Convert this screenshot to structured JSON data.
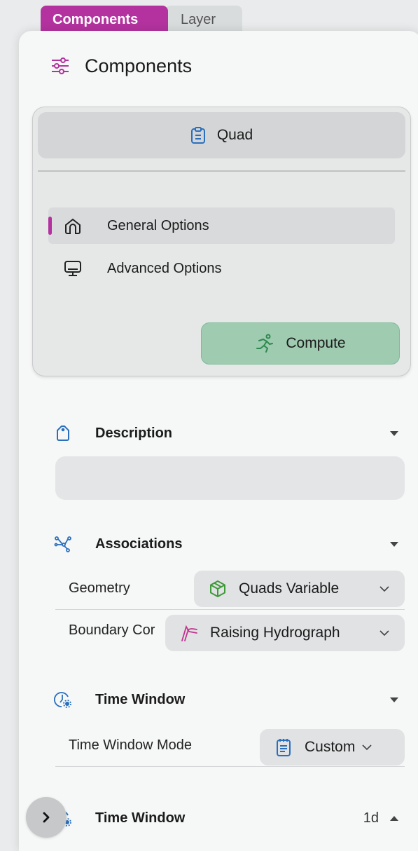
{
  "tabs": [
    {
      "label": "Components",
      "active": true
    },
    {
      "label": "Layer",
      "active": false
    }
  ],
  "header": {
    "title": "Components",
    "icon": "sliders-icon"
  },
  "card": {
    "quad_label": "Quad",
    "nav": [
      {
        "label": "General Options",
        "icon": "home-icon",
        "active": true
      },
      {
        "label": "Advanced Options",
        "icon": "monitor-icon",
        "active": false
      }
    ],
    "compute_label": "Compute"
  },
  "sections": {
    "description": {
      "title": "Description",
      "icon": "tag-icon",
      "value": ""
    },
    "associations": {
      "title": "Associations",
      "icon": "network-icon",
      "rows": [
        {
          "label": "Geometry",
          "value": "Quads Variable",
          "icon": "cube-icon"
        },
        {
          "label": "Boundary Cor",
          "value": "Raising Hydrograph",
          "icon": "hydrograph-icon"
        }
      ]
    },
    "time_window": {
      "title": "Time Window",
      "icon": "clock-gear-icon",
      "rows": [
        {
          "label": "Time Window Mode",
          "value": "Custom",
          "icon": "notepad-icon"
        }
      ]
    },
    "time_window_2": {
      "title": "Time Window",
      "value": "1d",
      "icon": "clock-gear-icon"
    }
  },
  "colors": {
    "accent": "#b3329f",
    "compute": "#9fcbb1",
    "icon_blue": "#2a6fbd",
    "icon_green": "#3f9a3a"
  }
}
